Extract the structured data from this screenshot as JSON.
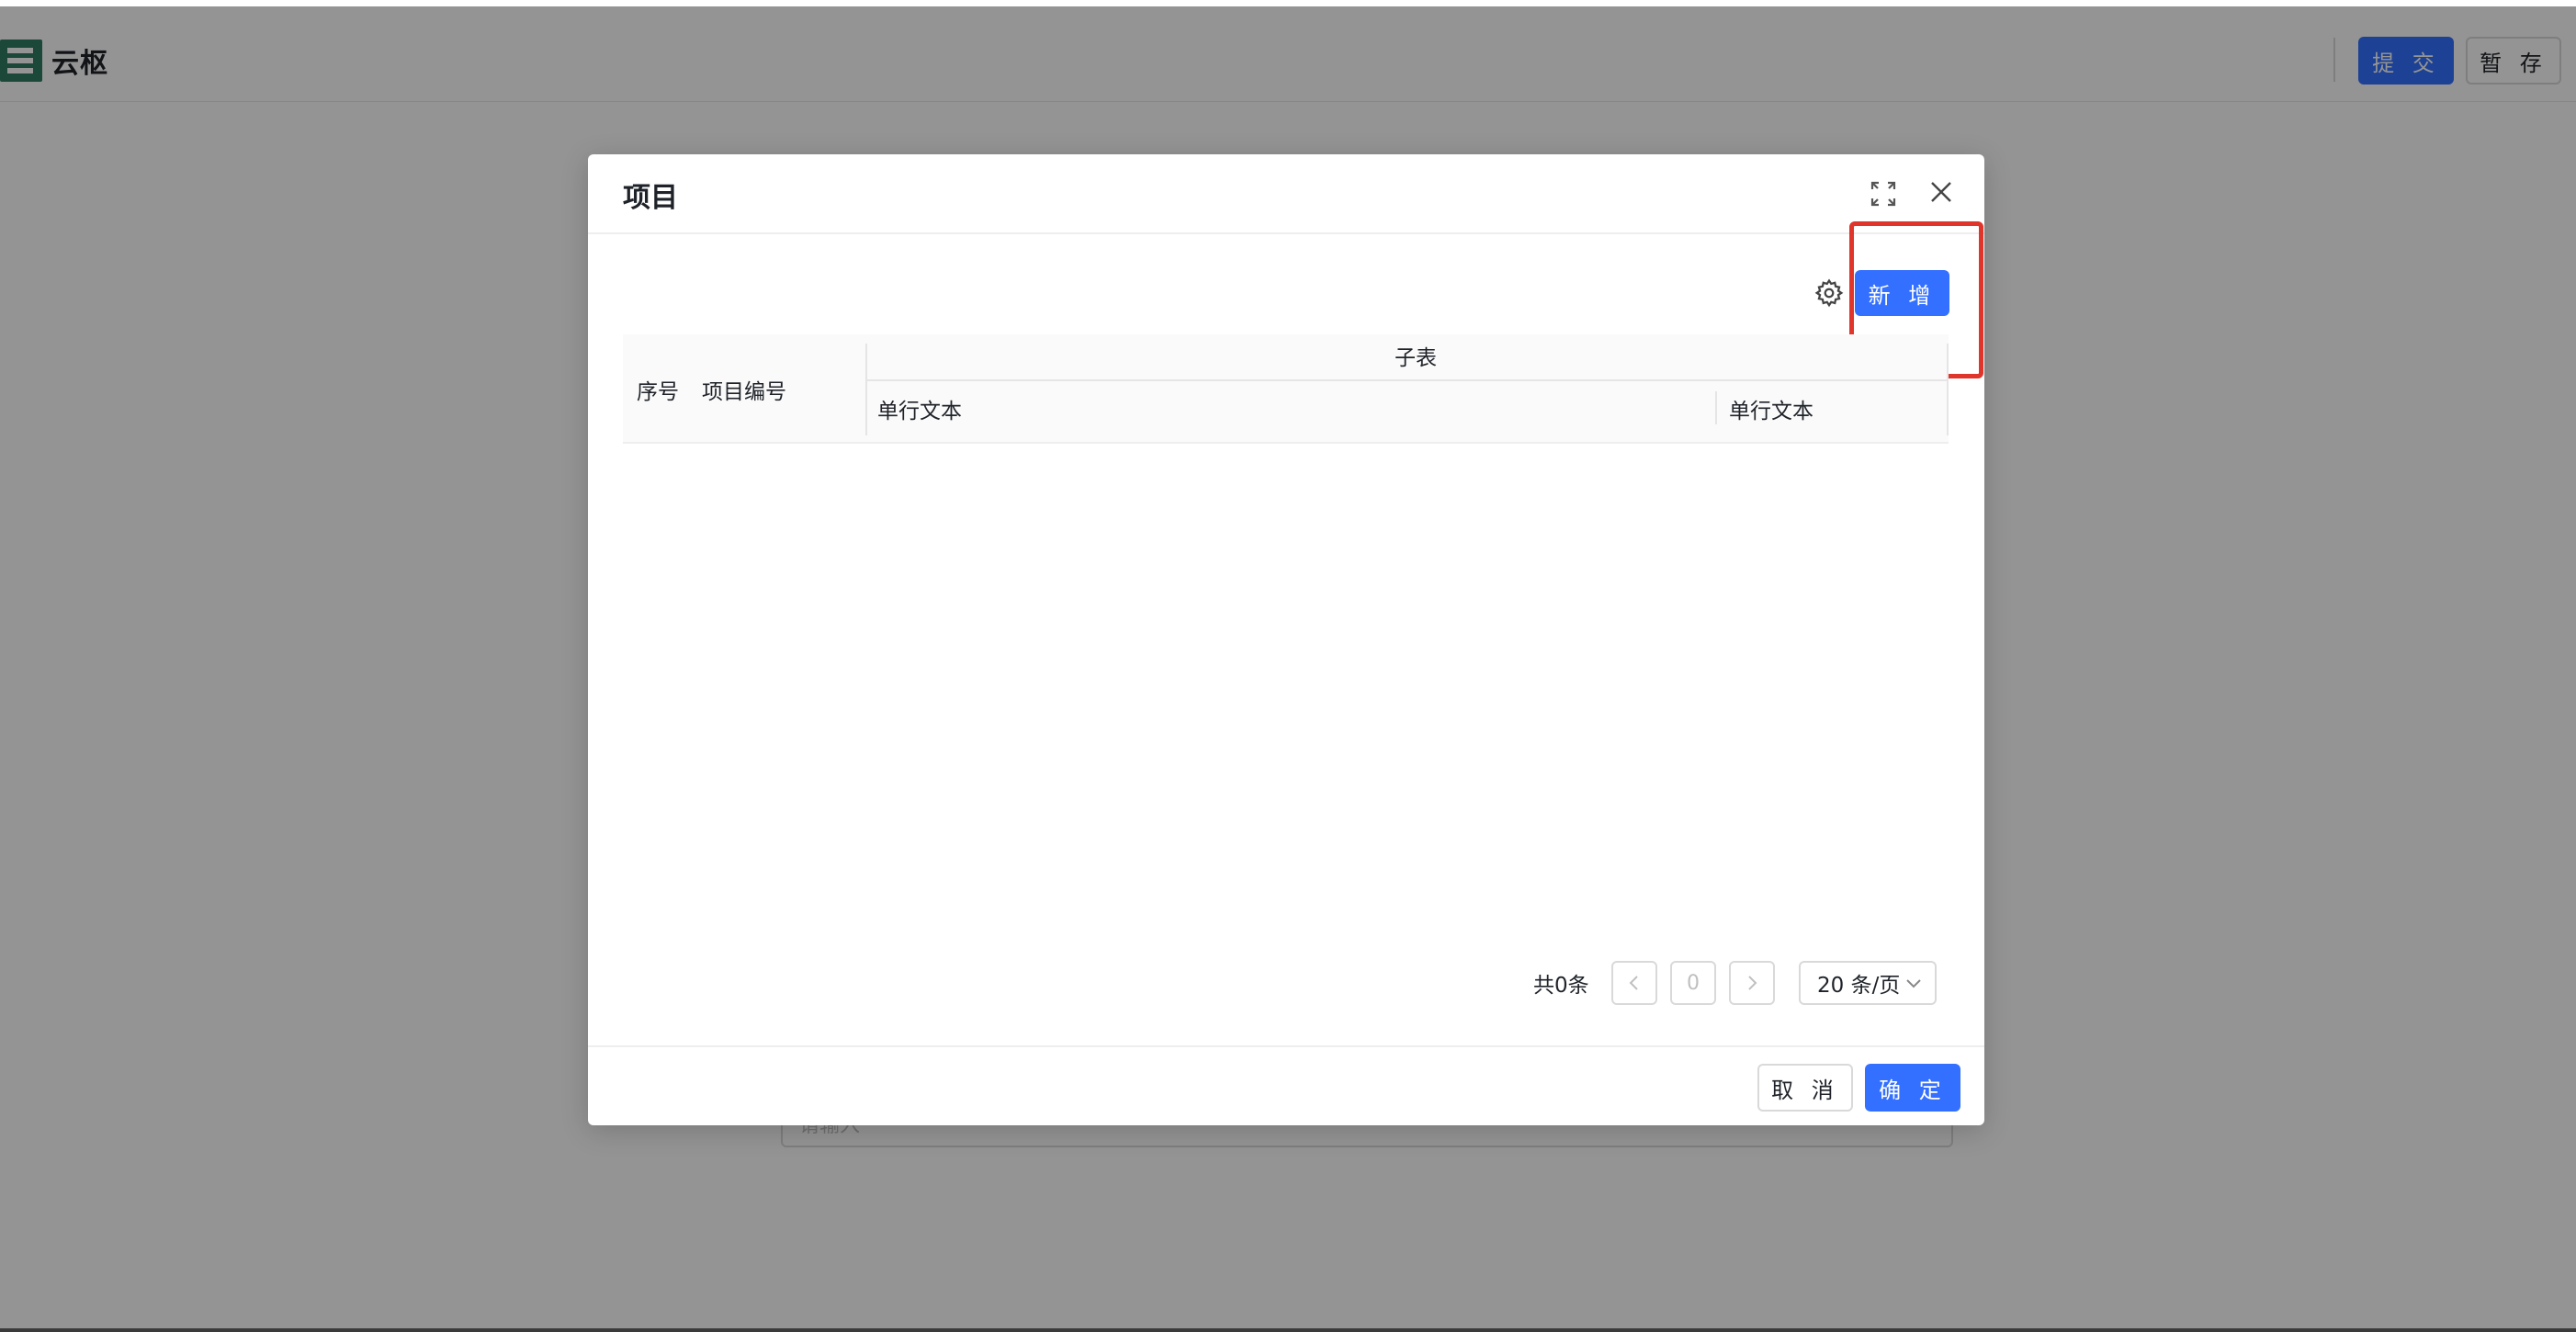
{
  "app": {
    "name": "云枢",
    "logo_icon": "yunshu-logo-icon"
  },
  "header": {
    "submit_label": "提 交",
    "draft_label": "暂 存"
  },
  "background_form": {
    "input_placeholder": "请输入"
  },
  "modal": {
    "title": "项目",
    "fullscreen_icon": "fullscreen-icon",
    "close_icon": "close-icon",
    "toolbar": {
      "settings_icon": "gear-icon",
      "add_label": "新 增"
    },
    "table": {
      "columns": {
        "seq": "序号",
        "code": "项目编号",
        "subtable": "子表",
        "sub_columns": [
          "单行文本",
          "单行文本"
        ]
      },
      "rows": []
    },
    "pagination": {
      "total_text": "共0条",
      "current_page": "0",
      "page_size": "20 条/页"
    },
    "footer": {
      "cancel_label": "取 消",
      "ok_label": "确 定"
    }
  },
  "colors": {
    "primary": "#3370ff",
    "highlight": "#e0352b",
    "logo": "#2f7d63"
  }
}
